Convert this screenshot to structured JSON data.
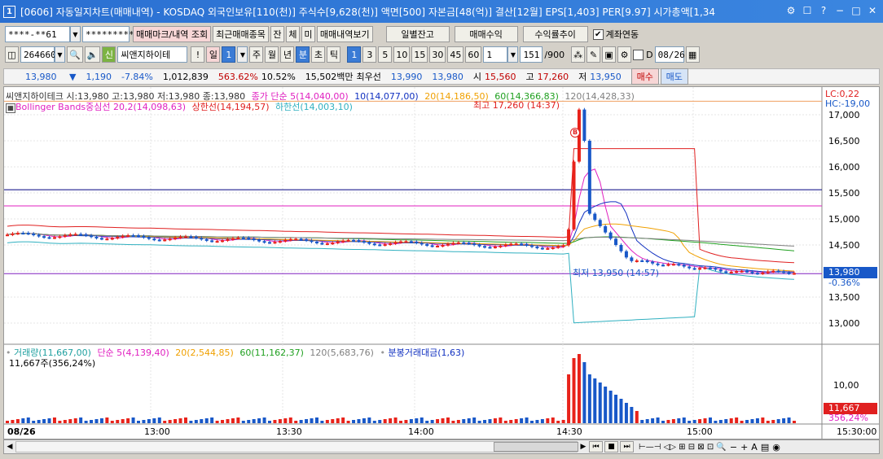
{
  "window": {
    "num": "1",
    "title": "[0606] 자동일지차트(매매내역) - KOSDAQ 외국인보유[110(천)] 주식수[9,628(천)] 액면[500] 자본금[48(억)] 결산[12월] EPS[1,403] PER[9.97] 시가총액[1,34"
  },
  "toolbar1": {
    "account": "****-**61",
    "password": "*********",
    "btn_mark": "매매마크/내역 조회",
    "btn_recent": "최근매매종목",
    "btn_jan": "잔",
    "btn_che": "체",
    "btn_mi": "미",
    "btn_view": "매매내역보기",
    "btn_daily": "일별잔고",
    "btn_profit": "매매수익",
    "btn_trend": "수익률추이",
    "chk_link": "계좌연동"
  },
  "toolbar2": {
    "code": "264660",
    "badge": "신",
    "stock_name": "씨앤지하이테",
    "excl": "!",
    "il": "일",
    "il_val": "1",
    "ju": "주",
    "wol": "월",
    "nyeon": "년",
    "bun": "분",
    "cho": "초",
    "tik": "틱",
    "periods": [
      "1",
      "3",
      "5",
      "10",
      "15",
      "30",
      "45",
      "60"
    ],
    "period_val": "1",
    "count": "151",
    "count_total": "/900",
    "d_label": "D",
    "date": "08/26"
  },
  "infobar": {
    "price": "13,980",
    "change": "1,190",
    "change_pct": "-7.84%",
    "volume": "1,012,839",
    "vol_ratio": "563.62%",
    "turnover": "10.52%",
    "amount": "15,502백만",
    "ask_label": "최우선",
    "ask": "13,990",
    "bid": "13,980",
    "open_label": "시",
    "open": "15,560",
    "high_label": "고",
    "high": "17,260",
    "low_label": "저",
    "low": "13,950",
    "buy": "매수",
    "sell": "매도"
  },
  "price_panel": {
    "legend1": "씨앤지하이테크 시:13,980 고:13,980 저:13,980 종:13,980",
    "legend_ma": "종가 단순 5(14,040,00)",
    "legend_10": "10(14,077,00)",
    "legend_20": "20(14,186,50)",
    "legend_60": "60(14,366,83)",
    "legend_120": "120(14,428,33)",
    "legend_bb": "Bollinger Bands중심선 20,2(14,098,63)",
    "legend_up": "상한선(14,194,57)",
    "legend_dn": "하한선(14,003,10)",
    "high_annot": "최고 17,260 (14:37)",
    "low_annot": "최저 13,950 (14:57)",
    "lc": "LC:0,22",
    "hc": "HC:-19,00",
    "yticks": [
      "17,000",
      "16,500",
      "16,000",
      "15,500",
      "15,000",
      "14,500",
      "14,000",
      "13,500",
      "13,000"
    ],
    "cur_price": "13,980",
    "cur_pct": "-0.36%",
    "b_marker": "B"
  },
  "volume_panel": {
    "legend_vol": "거래량(11,667,00)",
    "legend_ma5": "단순 5(4,139,40)",
    "legend_20": "20(2,544,85)",
    "legend_60": "60(11,162,37)",
    "legend_120": "120(5,683,76)",
    "legend_amt": "분봉거래대금(1,63)",
    "sub": "11,667주(356,24%)",
    "ytick": "10,00",
    "cur_vol": "11,667",
    "cur_pct": "356,24%"
  },
  "xaxis": {
    "labels": [
      "08/26",
      "13:00",
      "13:30",
      "14:00",
      "14:30",
      "15:00",
      "15:30:00"
    ]
  },
  "colors": {
    "up": "#e8221a",
    "down": "#1858c8",
    "ma5": "#e020c0",
    "ma10": "#1030c0",
    "ma20": "#f0a000",
    "ma60": "#20a020",
    "ma120": "#808080",
    "bb_up": "#e02020",
    "bb_dn": "#30b0c0"
  }
}
